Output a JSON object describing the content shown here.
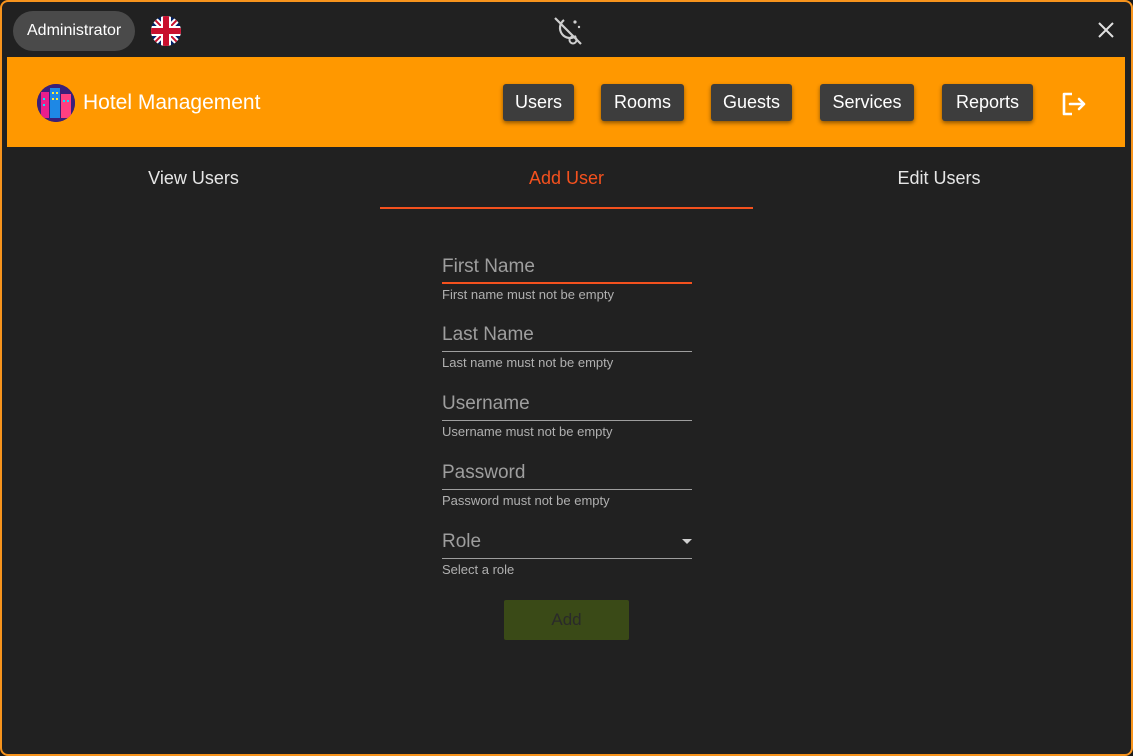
{
  "titlebar": {
    "user_role": "Administrator",
    "language_flag": "uk-flag-icon",
    "theme_icon": "theme-toggle-icon",
    "close_icon": "close-icon"
  },
  "appbar": {
    "title": "Hotel Management",
    "logo": "hotel-logo-icon",
    "nav": [
      {
        "label": "Users"
      },
      {
        "label": "Rooms"
      },
      {
        "label": "Guests"
      },
      {
        "label": "Services"
      },
      {
        "label": "Reports"
      }
    ],
    "logout_icon": "logout-icon",
    "color": "#ff9800"
  },
  "tabs": [
    {
      "label": "View Users",
      "active": false
    },
    {
      "label": "Add User",
      "active": true
    },
    {
      "label": "Edit Users",
      "active": false
    }
  ],
  "form": {
    "first_name": {
      "placeholder": "First Name",
      "hint": "First name must not be empty"
    },
    "last_name": {
      "placeholder": "Last Name",
      "hint": "Last name must not be empty"
    },
    "username": {
      "placeholder": "Username",
      "hint": "Username must not be empty"
    },
    "password": {
      "placeholder": "Password",
      "hint": "Password must not be empty"
    },
    "role": {
      "placeholder": "Role",
      "hint": "Select a role"
    },
    "submit_label": "Add"
  },
  "colors": {
    "accent": "#f4511e",
    "border": "#f7941d",
    "background": "#212121",
    "disabled_button": "#3a4a17"
  }
}
